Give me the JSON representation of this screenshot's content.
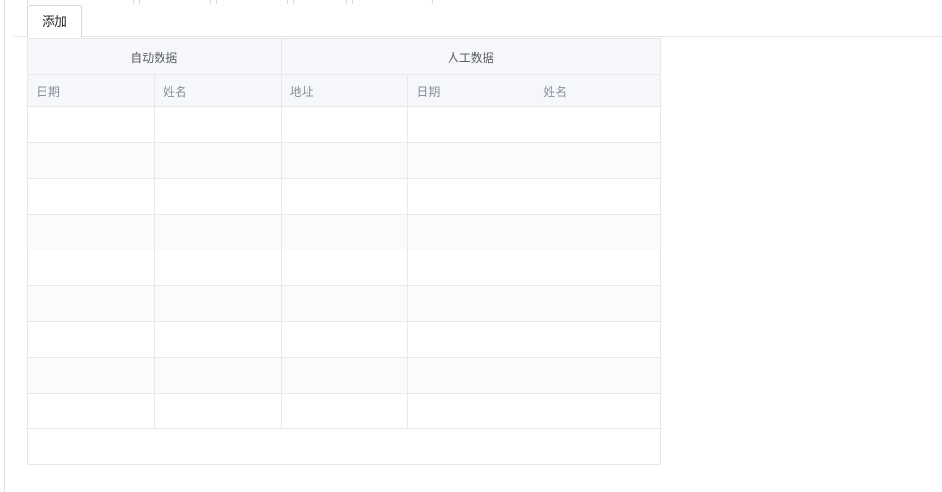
{
  "tab": {
    "active_label": "添加"
  },
  "table": {
    "group_headers": {
      "auto": "自动数据",
      "manual": "人工数据"
    },
    "columns": {
      "c0": "日期",
      "c1": "姓名",
      "c2": "地址",
      "c3": "日期",
      "c4": "姓名"
    },
    "rows": [
      {
        "c0": "",
        "c1": "",
        "c2": "",
        "c3": "",
        "c4": ""
      },
      {
        "c0": "",
        "c1": "",
        "c2": "",
        "c3": "",
        "c4": ""
      },
      {
        "c0": "",
        "c1": "",
        "c2": "",
        "c3": "",
        "c4": ""
      },
      {
        "c0": "",
        "c1": "",
        "c2": "",
        "c3": "",
        "c4": ""
      },
      {
        "c0": "",
        "c1": "",
        "c2": "",
        "c3": "",
        "c4": ""
      },
      {
        "c0": "",
        "c1": "",
        "c2": "",
        "c3": "",
        "c4": ""
      },
      {
        "c0": "",
        "c1": "",
        "c2": "",
        "c3": "",
        "c4": ""
      },
      {
        "c0": "",
        "c1": "",
        "c2": "",
        "c3": "",
        "c4": ""
      },
      {
        "c0": "",
        "c1": "",
        "c2": "",
        "c3": "",
        "c4": ""
      }
    ]
  }
}
